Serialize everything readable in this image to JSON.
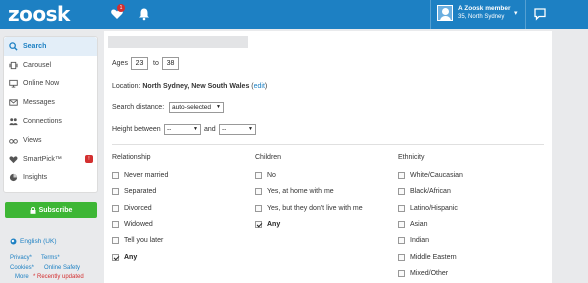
{
  "header": {
    "logo": "zoosk",
    "notification_count": "1",
    "user_name": "A Zoosk member",
    "user_location": "35, North Sydney"
  },
  "sidebar": {
    "items": [
      {
        "label": "Search",
        "icon": "search-icon"
      },
      {
        "label": "Carousel",
        "icon": "carousel-icon"
      },
      {
        "label": "Online Now",
        "icon": "monitor-icon"
      },
      {
        "label": "Messages",
        "icon": "envelope-icon"
      },
      {
        "label": "Connections",
        "icon": "connections-icon"
      },
      {
        "label": "Views",
        "icon": "glasses-icon"
      },
      {
        "label": "SmartPick™",
        "icon": "heart-icon",
        "badge": "!"
      },
      {
        "label": "Insights",
        "icon": "insights-icon"
      }
    ],
    "subscribe_label": "Subscribe",
    "language": "English (UK)",
    "footer": {
      "privacy": "Privacy*",
      "terms": "Terms*",
      "cookies": "Cookies*",
      "online_safety": "Online Safety",
      "more": "More",
      "recently_updated": "* Recently updated"
    }
  },
  "search": {
    "ages_label": "Ages",
    "age_min": "23",
    "to_label": "to",
    "age_max": "38",
    "location_label": "Location:",
    "location_value": "North Sydney, New South Wales",
    "edit_label": "edit",
    "distance_label": "Search distance:",
    "distance_value": "auto-selected",
    "height_label": "Height between",
    "height_min": "--",
    "and_label": "and",
    "height_max": "--"
  },
  "filters": {
    "relationship": {
      "title": "Relationship",
      "options": [
        {
          "label": "Never married",
          "checked": false
        },
        {
          "label": "Separated",
          "checked": false
        },
        {
          "label": "Divorced",
          "checked": false
        },
        {
          "label": "Widowed",
          "checked": false
        },
        {
          "label": "Tell you later",
          "checked": false
        },
        {
          "label": "Any",
          "checked": true
        }
      ]
    },
    "children": {
      "title": "Children",
      "options": [
        {
          "label": "No",
          "checked": false
        },
        {
          "label": "Yes, at home with me",
          "checked": false
        },
        {
          "label": "Yes, but they don't live with me",
          "checked": false
        },
        {
          "label": "Any",
          "checked": true
        }
      ]
    },
    "ethnicity": {
      "title": "Ethnicity",
      "options": [
        {
          "label": "White/Caucasian",
          "checked": false
        },
        {
          "label": "Black/African",
          "checked": false
        },
        {
          "label": "Latino/Hispanic",
          "checked": false
        },
        {
          "label": "Asian",
          "checked": false
        },
        {
          "label": "Indian",
          "checked": false
        },
        {
          "label": "Middle Eastern",
          "checked": false
        },
        {
          "label": "Mixed/Other",
          "checked": false
        }
      ]
    }
  },
  "colors": {
    "brand_blue": "#1d80c3",
    "subscribe_green": "#3db635",
    "alert_red": "#d32f2f"
  }
}
